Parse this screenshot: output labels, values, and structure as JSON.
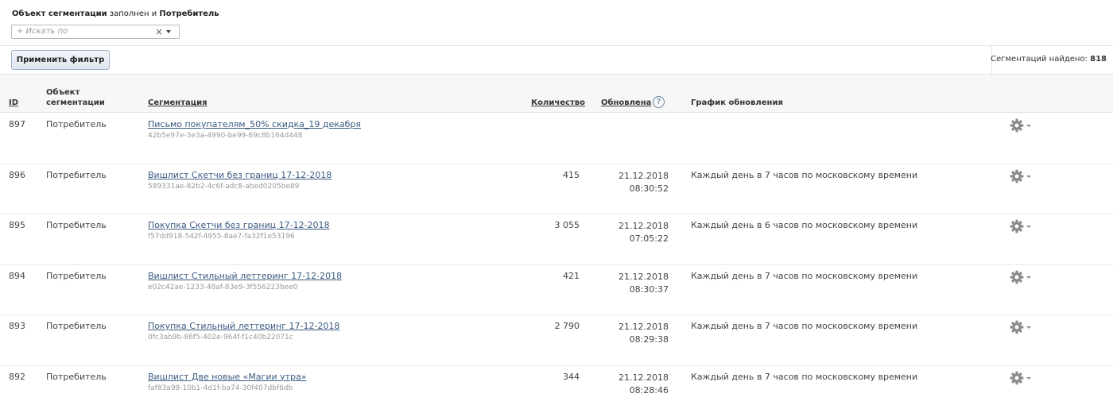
{
  "filter": {
    "field": "Объект сегментации",
    "op": "заполнен",
    "conj": "и",
    "value": "Потребитель",
    "search_placeholder": "+ Искать по",
    "clear_glyph": "×"
  },
  "actions": {
    "apply_label": "Применить фильтр",
    "found_label": "Сегментаций найдено:",
    "found_count": "818"
  },
  "columns": {
    "id": "ID",
    "object_line1": "Объект",
    "object_line2": "сегментации",
    "segmentation": "Сегментация",
    "count": "Количество",
    "updated": "Обновлена",
    "help": "?",
    "schedule": "График обновления"
  },
  "rows": [
    {
      "id": "897",
      "object": "Потребитель",
      "name": "Письмо покупателям_50% скидка_19 декабря",
      "uuid": "42b5e97e-3e3a-4990-be99-69c8b164d448",
      "count": "",
      "date": "",
      "time": "",
      "schedule": ""
    },
    {
      "id": "896",
      "object": "Потребитель",
      "name": "Вишлист Скетчи без границ 17-12-2018",
      "uuid": "589331ae-82b2-4c6f-adc8-abed0205be89",
      "count": "415",
      "date": "21.12.2018",
      "time": "08:30:52",
      "schedule": "Каждый день в 7 часов по московскому времени"
    },
    {
      "id": "895",
      "object": "Потребитель",
      "name": "Покупка Скетчи без границ 17-12-2018",
      "uuid": "f57dd918-542f-4955-8ae7-fa32f1e53196",
      "count": "3 055",
      "date": "21.12.2018",
      "time": "07:05:22",
      "schedule": "Каждый день в 6 часов по московскому времени"
    },
    {
      "id": "894",
      "object": "Потребитель",
      "name": "Вишлист Стильный леттеринг 17-12-2018",
      "uuid": "e02c42ae-1233-48af-83e9-3f556223bee0",
      "count": "421",
      "date": "21.12.2018",
      "time": "08:30:37",
      "schedule": "Каждый день в 7 часов по московскому времени"
    },
    {
      "id": "893",
      "object": "Потребитель",
      "name": "Покупка Стильный леттеринг 17-12-2018",
      "uuid": "0fc3ab9b-86f5-402e-964f-f1c40b22071c",
      "count": "2 790",
      "date": "21.12.2018",
      "time": "08:29:38",
      "schedule": "Каждый день в 7 часов по московскому времени"
    },
    {
      "id": "892",
      "object": "Потребитель",
      "name": "Вишлист Две новые «Магии утра»",
      "uuid": "faf83a99-10b1-4d1f-ba74-30f407dbf6db",
      "count": "344",
      "date": "21.12.2018",
      "time": "08:28:46",
      "schedule": "Каждый день в 7 часов по московскому времени"
    }
  ],
  "icons": {
    "row_settings": "gear-icon",
    "row_settings_caret": "chevron-down-icon",
    "help": "question-circle-icon",
    "search_clear": "close-icon",
    "search_dropdown": "chevron-down-icon"
  },
  "colors": {
    "link": "#3a5a80",
    "gear": "#8a8a8a",
    "button_border": "#9db2c8"
  }
}
